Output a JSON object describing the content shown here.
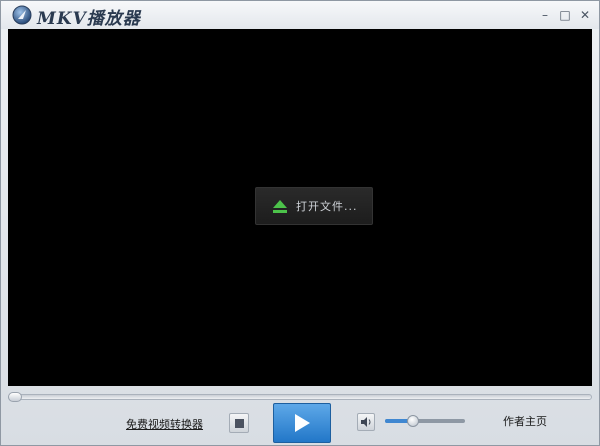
{
  "window": {
    "title": "MKV播放器",
    "controls": {
      "minimize": "–",
      "maximize": "□",
      "close": "✕"
    }
  },
  "video": {
    "open_file_label": "打开文件...",
    "open_file_icon": "eject-icon"
  },
  "playback": {
    "progress": 0,
    "play_icon": "play-icon",
    "stop_icon": "stop-icon",
    "volume_icon": "speaker-icon",
    "volume_level": 0.35
  },
  "links": {
    "converter": "免费视频转换器",
    "author": "作者主页"
  },
  "colors": {
    "accent": "#2f86d6",
    "eject": "#4cc24a"
  }
}
